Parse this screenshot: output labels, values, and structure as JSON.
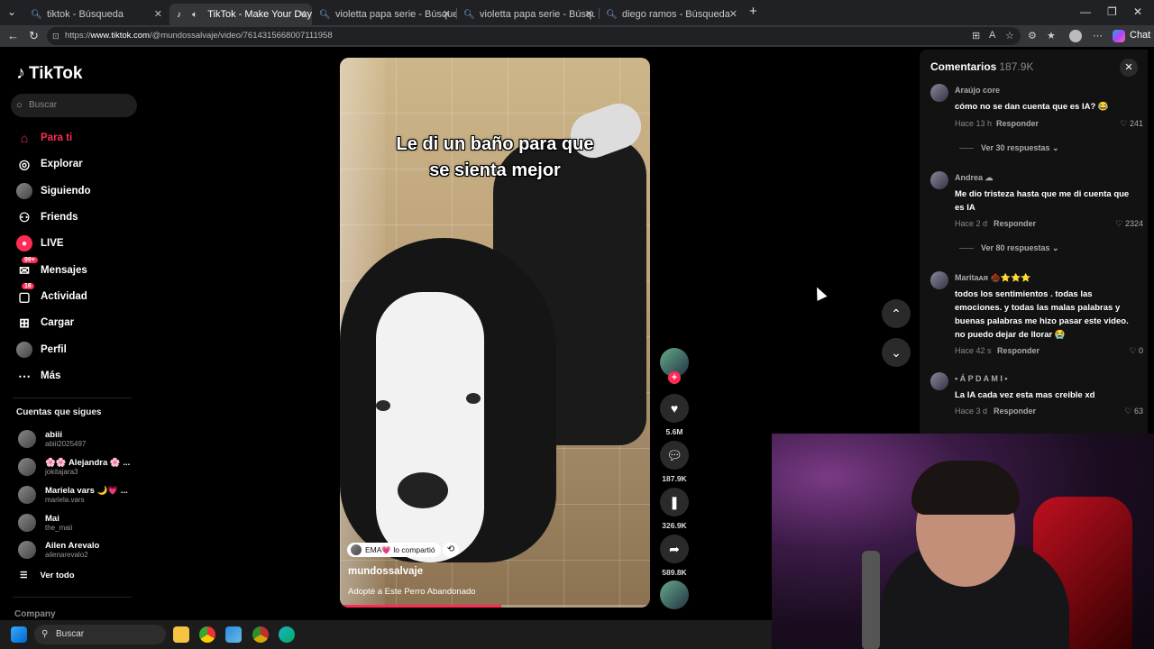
{
  "browser": {
    "tabs": [
      {
        "label": "tiktok - Búsqueda",
        "active": false
      },
      {
        "label": "TikTok - Make Your Day",
        "active": true
      },
      {
        "label": "violetta papa serie - Búsqueda",
        "active": false
      },
      {
        "label": "violetta papa serie - Búsqueda Imá",
        "active": false
      },
      {
        "label": "diego ramos - Búsqueda",
        "active": false
      }
    ],
    "url_prefix": "https://",
    "url_host": "www.tiktok.com",
    "url_path": "/@mundossalvaje/video/7614315668007111958",
    "copilot_label": "Chat"
  },
  "sidebar": {
    "logo": "TikTok",
    "search_placeholder": "Buscar",
    "nav": [
      {
        "label": "Para ti",
        "icon": "home-icon",
        "active": true
      },
      {
        "label": "Explorar",
        "icon": "compass-icon"
      },
      {
        "label": "Siguiendo",
        "icon": "following-avatar-icon"
      },
      {
        "label": "Friends",
        "icon": "friends-icon"
      },
      {
        "label": "LIVE",
        "icon": "live-icon"
      },
      {
        "label": "Mensajes",
        "icon": "messages-icon",
        "badge": "99+"
      },
      {
        "label": "Actividad",
        "icon": "activity-icon",
        "badge": "16"
      },
      {
        "label": "Cargar",
        "icon": "upload-icon"
      },
      {
        "label": "Perfil",
        "icon": "profile-avatar-icon"
      },
      {
        "label": "Más",
        "icon": "more-icon"
      }
    ],
    "following_title": "Cuentas que sigues",
    "following": [
      {
        "name": "abiii",
        "user": "abiii2025497"
      },
      {
        "name": "🌸🌸 Alejandra 🌸 ...",
        "user": "jokitajara3"
      },
      {
        "name": "Mariela vars 🌙💗 ...",
        "user": "mariela.vars"
      },
      {
        "name": "Mai",
        "user": "the_maii"
      },
      {
        "name": "Ailen Arevalo",
        "user": "ailenarevalo2"
      }
    ],
    "see_all": "Ver todo",
    "company": "Company"
  },
  "video": {
    "caption": "Le di un baño para que\nse sienta mejor",
    "repost_label": "EMA💗 lo compartió",
    "author": "mundossalvaje",
    "description": "Adopté a Este Perro Abandonado",
    "progress_percent": 52
  },
  "actions": {
    "likes": "5.6M",
    "comments": "187.9K",
    "saves": "326.9K",
    "shares": "589.8K"
  },
  "comments_panel": {
    "title": "Comentarios",
    "count": "187.9K",
    "reply_label": "Responder",
    "items": [
      {
        "user": "Araújo core",
        "text": "cómo no se dan cuenta que es IA? 😂",
        "time": "Hace 13 h",
        "likes": "241",
        "more": "Ver 30 respuestas ⌄"
      },
      {
        "user": "Andrea ☁",
        "text": "Me dio tristeza hasta que me di cuenta que es IA",
        "time": "Hace 2 d",
        "likes": "2324",
        "more": "Ver 80 respuestas ⌄"
      },
      {
        "user": "Maritaᴀᴙ 🌰⭐⭐⭐",
        "text": "todos los sentimientos . todas las emociones. y todas las malas palabras y buenas palabras me hizo pasar este video. no puedo dejar de llorar 😭",
        "time": "Hace 42 s",
        "likes": "0"
      },
      {
        "user": "• Á P D A M I •",
        "text": "La IA cada vez esta mas creible xd",
        "time": "Hace 3 d",
        "likes": "63"
      }
    ]
  },
  "taskbar": {
    "search_label": "Buscar"
  },
  "colors": {
    "accent": "#fe2c55",
    "panel": "#121212"
  }
}
